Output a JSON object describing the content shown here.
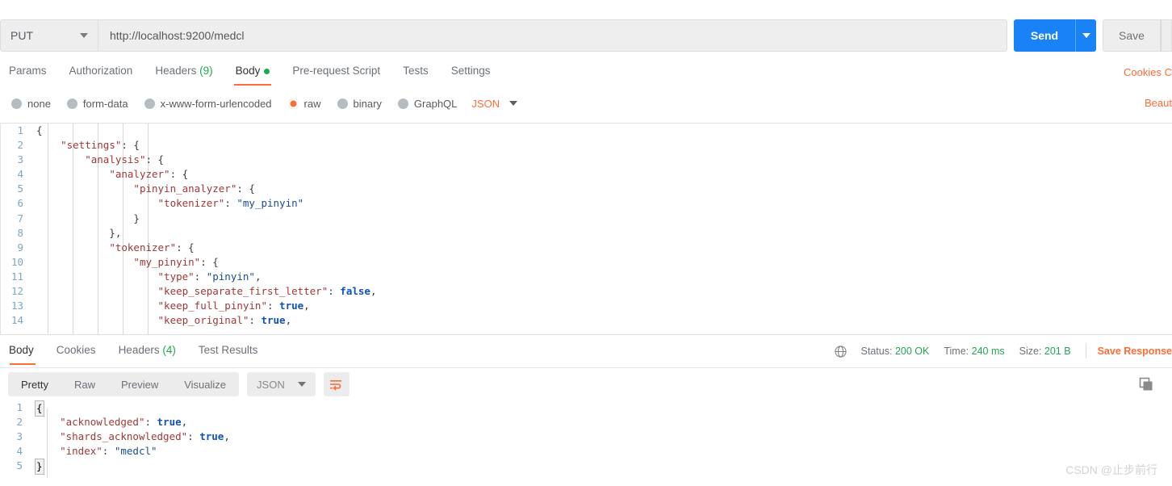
{
  "request": {
    "method": "PUT",
    "url": "http://localhost:9200/medcl",
    "send_label": "Send",
    "save_label": "Save",
    "tabs": [
      {
        "label": "Params",
        "active": false
      },
      {
        "label": "Authorization",
        "active": false
      },
      {
        "label": "Headers",
        "count": "(9)",
        "active": false
      },
      {
        "label": "Body",
        "active": true,
        "dot": true
      },
      {
        "label": "Pre-request Script",
        "active": false
      },
      {
        "label": "Tests",
        "active": false
      },
      {
        "label": "Settings",
        "active": false
      }
    ],
    "right_links": "Cookies  C",
    "beautify_label": "Beaut",
    "body_types": [
      {
        "label": "none",
        "selected": false
      },
      {
        "label": "form-data",
        "selected": false
      },
      {
        "label": "x-www-form-urlencoded",
        "selected": false
      },
      {
        "label": "raw",
        "selected": true
      },
      {
        "label": "binary",
        "selected": false
      },
      {
        "label": "GraphQL",
        "selected": false
      }
    ],
    "format_label": "JSON",
    "body_lines": [
      {
        "n": "1",
        "segments": [
          {
            "t": "{",
            "c": "p"
          }
        ]
      },
      {
        "n": "2",
        "segments": [
          {
            "t": "    ",
            "c": "p"
          },
          {
            "t": "\"settings\"",
            "c": "k"
          },
          {
            "t": ": {",
            "c": "p"
          }
        ]
      },
      {
        "n": "3",
        "segments": [
          {
            "t": "        ",
            "c": "p"
          },
          {
            "t": "\"analysis\"",
            "c": "k"
          },
          {
            "t": ": {",
            "c": "p"
          }
        ]
      },
      {
        "n": "4",
        "segments": [
          {
            "t": "            ",
            "c": "p"
          },
          {
            "t": "\"analyzer\"",
            "c": "k"
          },
          {
            "t": ": {",
            "c": "p"
          }
        ]
      },
      {
        "n": "5",
        "segments": [
          {
            "t": "                ",
            "c": "p"
          },
          {
            "t": "\"pinyin_analyzer\"",
            "c": "k"
          },
          {
            "t": ": {",
            "c": "p"
          }
        ]
      },
      {
        "n": "6",
        "segments": [
          {
            "t": "                    ",
            "c": "p"
          },
          {
            "t": "\"tokenizer\"",
            "c": "k"
          },
          {
            "t": ": ",
            "c": "p"
          },
          {
            "t": "\"my_pinyin\"",
            "c": "s"
          }
        ]
      },
      {
        "n": "7",
        "segments": [
          {
            "t": "                }",
            "c": "p"
          }
        ]
      },
      {
        "n": "8",
        "segments": [
          {
            "t": "            },",
            "c": "p"
          }
        ]
      },
      {
        "n": "9",
        "segments": [
          {
            "t": "            ",
            "c": "p"
          },
          {
            "t": "\"tokenizer\"",
            "c": "k"
          },
          {
            "t": ": {",
            "c": "p"
          }
        ]
      },
      {
        "n": "10",
        "segments": [
          {
            "t": "                ",
            "c": "p"
          },
          {
            "t": "\"my_pinyin\"",
            "c": "k"
          },
          {
            "t": ": {",
            "c": "p"
          }
        ]
      },
      {
        "n": "11",
        "segments": [
          {
            "t": "                    ",
            "c": "p"
          },
          {
            "t": "\"type\"",
            "c": "k"
          },
          {
            "t": ": ",
            "c": "p"
          },
          {
            "t": "\"pinyin\"",
            "c": "s"
          },
          {
            "t": ",",
            "c": "p"
          }
        ]
      },
      {
        "n": "12",
        "segments": [
          {
            "t": "                    ",
            "c": "p"
          },
          {
            "t": "\"keep_separate_first_letter\"",
            "c": "k"
          },
          {
            "t": ": ",
            "c": "p"
          },
          {
            "t": "false",
            "c": "b"
          },
          {
            "t": ",",
            "c": "p"
          }
        ]
      },
      {
        "n": "13",
        "segments": [
          {
            "t": "                    ",
            "c": "p"
          },
          {
            "t": "\"keep_full_pinyin\"",
            "c": "k"
          },
          {
            "t": ": ",
            "c": "p"
          },
          {
            "t": "true",
            "c": "b"
          },
          {
            "t": ",",
            "c": "p"
          }
        ]
      },
      {
        "n": "14",
        "segments": [
          {
            "t": "                    ",
            "c": "p"
          },
          {
            "t": "\"keep_original\"",
            "c": "k"
          },
          {
            "t": ": ",
            "c": "p"
          },
          {
            "t": "true",
            "c": "b"
          },
          {
            "t": ",",
            "c": "p"
          }
        ]
      }
    ]
  },
  "response": {
    "tabs": [
      {
        "label": "Body",
        "active": true
      },
      {
        "label": "Cookies",
        "active": false
      },
      {
        "label": "Headers",
        "count": "(4)",
        "active": false
      },
      {
        "label": "Test Results",
        "active": false
      }
    ],
    "status_label": "Status:",
    "status_value": "200 OK",
    "time_label": "Time:",
    "time_value": "240 ms",
    "size_label": "Size:",
    "size_value": "201 B",
    "save_response_label": "Save Response",
    "view_modes": [
      {
        "label": "Pretty",
        "active": true
      },
      {
        "label": "Raw",
        "active": false
      },
      {
        "label": "Preview",
        "active": false
      },
      {
        "label": "Visualize",
        "active": false
      }
    ],
    "format_label": "JSON",
    "body_lines": [
      {
        "n": "1",
        "box": "{",
        "segments": []
      },
      {
        "n": "2",
        "segments": [
          {
            "t": "    ",
            "c": "p"
          },
          {
            "t": "\"acknowledged\"",
            "c": "k"
          },
          {
            "t": ": ",
            "c": "p"
          },
          {
            "t": "true",
            "c": "b"
          },
          {
            "t": ",",
            "c": "p"
          }
        ]
      },
      {
        "n": "3",
        "segments": [
          {
            "t": "    ",
            "c": "p"
          },
          {
            "t": "\"shards_acknowledged\"",
            "c": "k"
          },
          {
            "t": ": ",
            "c": "p"
          },
          {
            "t": "true",
            "c": "b"
          },
          {
            "t": ",",
            "c": "p"
          }
        ]
      },
      {
        "n": "4",
        "segments": [
          {
            "t": "    ",
            "c": "p"
          },
          {
            "t": "\"index\"",
            "c": "k"
          },
          {
            "t": ": ",
            "c": "p"
          },
          {
            "t": "\"medcl\"",
            "c": "s"
          }
        ]
      },
      {
        "n": "5",
        "box": "}",
        "segments": []
      }
    ]
  },
  "watermark": "CSDN @止步前行",
  "colors": {
    "accent_orange": "#ff6c37",
    "send_blue": "#1a82f7",
    "status_green": "#23a455"
  }
}
